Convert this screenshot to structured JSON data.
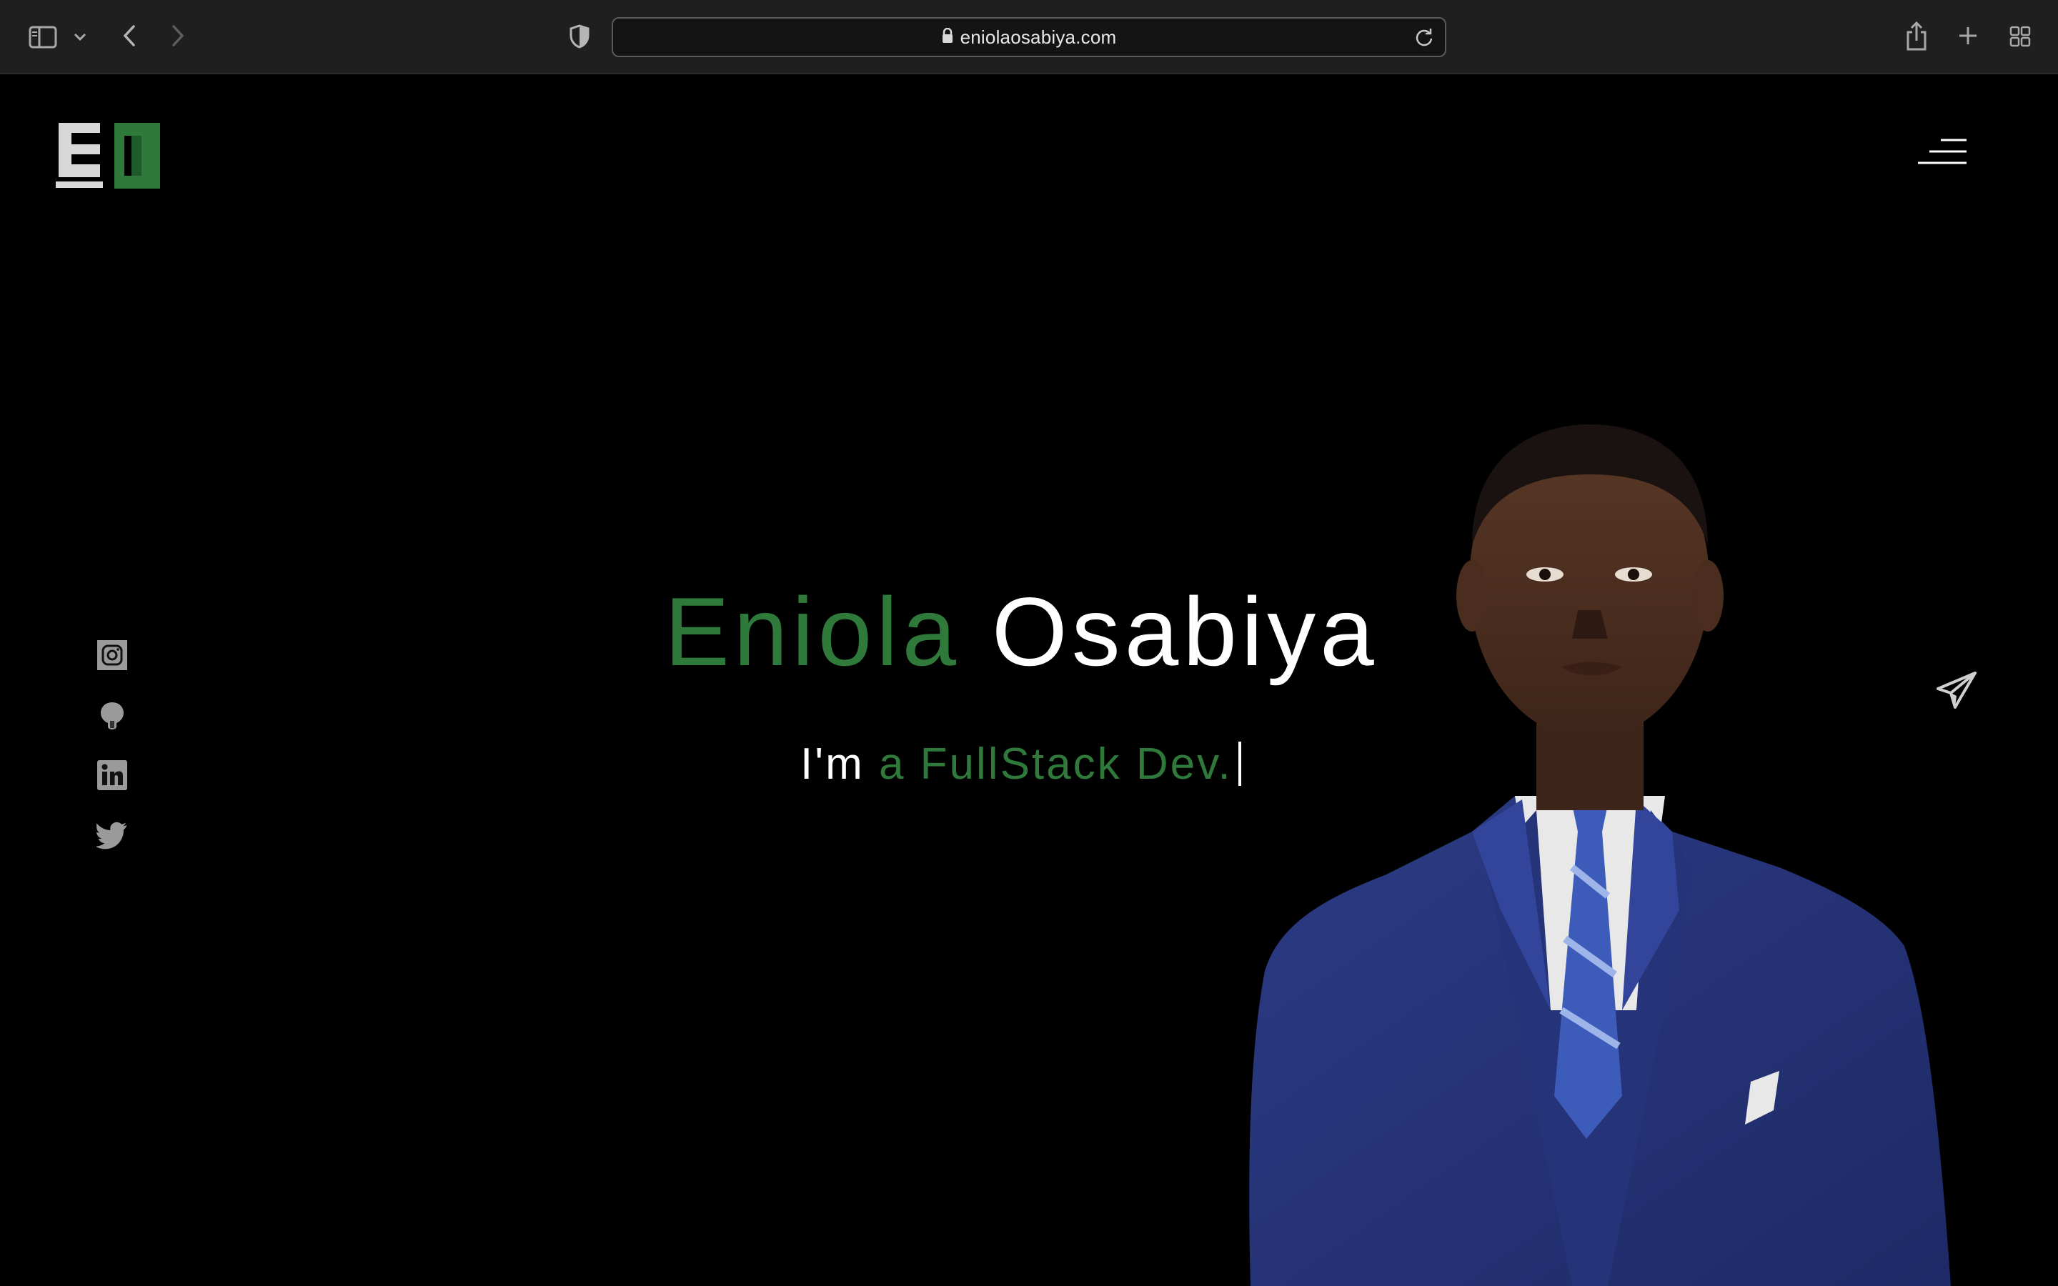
{
  "browser": {
    "url": "eniolaosabiya.com",
    "icons": {
      "sidebar": "sidebar-icon",
      "dropdown": "chevron-down-icon",
      "back": "back-arrow-icon",
      "forward": "forward-arrow-icon",
      "privacy": "privacy-shield-icon",
      "lock": "lock-icon",
      "reload": "reload-icon",
      "share": "share-icon",
      "new_tab": "plus-icon",
      "tab_overview": "tab-grid-icon"
    }
  },
  "page": {
    "logo": "EO",
    "hero": {
      "first_name": "Eniola",
      "last_name": "Osabiya",
      "subtitle_prefix": "I'm",
      "subtitle_typed": "a FullStack Dev."
    },
    "social_icons": [
      "instagram-icon",
      "github-icon",
      "linkedin-icon",
      "twitter-icon"
    ],
    "menu_icon": "hamburger-menu-icon",
    "contact_icon": "paper-plane-icon",
    "colors": {
      "accent": "#2f7a3b",
      "text": "#ffffff",
      "background": "#000000",
      "toolbar": "#1f1f1f"
    }
  }
}
